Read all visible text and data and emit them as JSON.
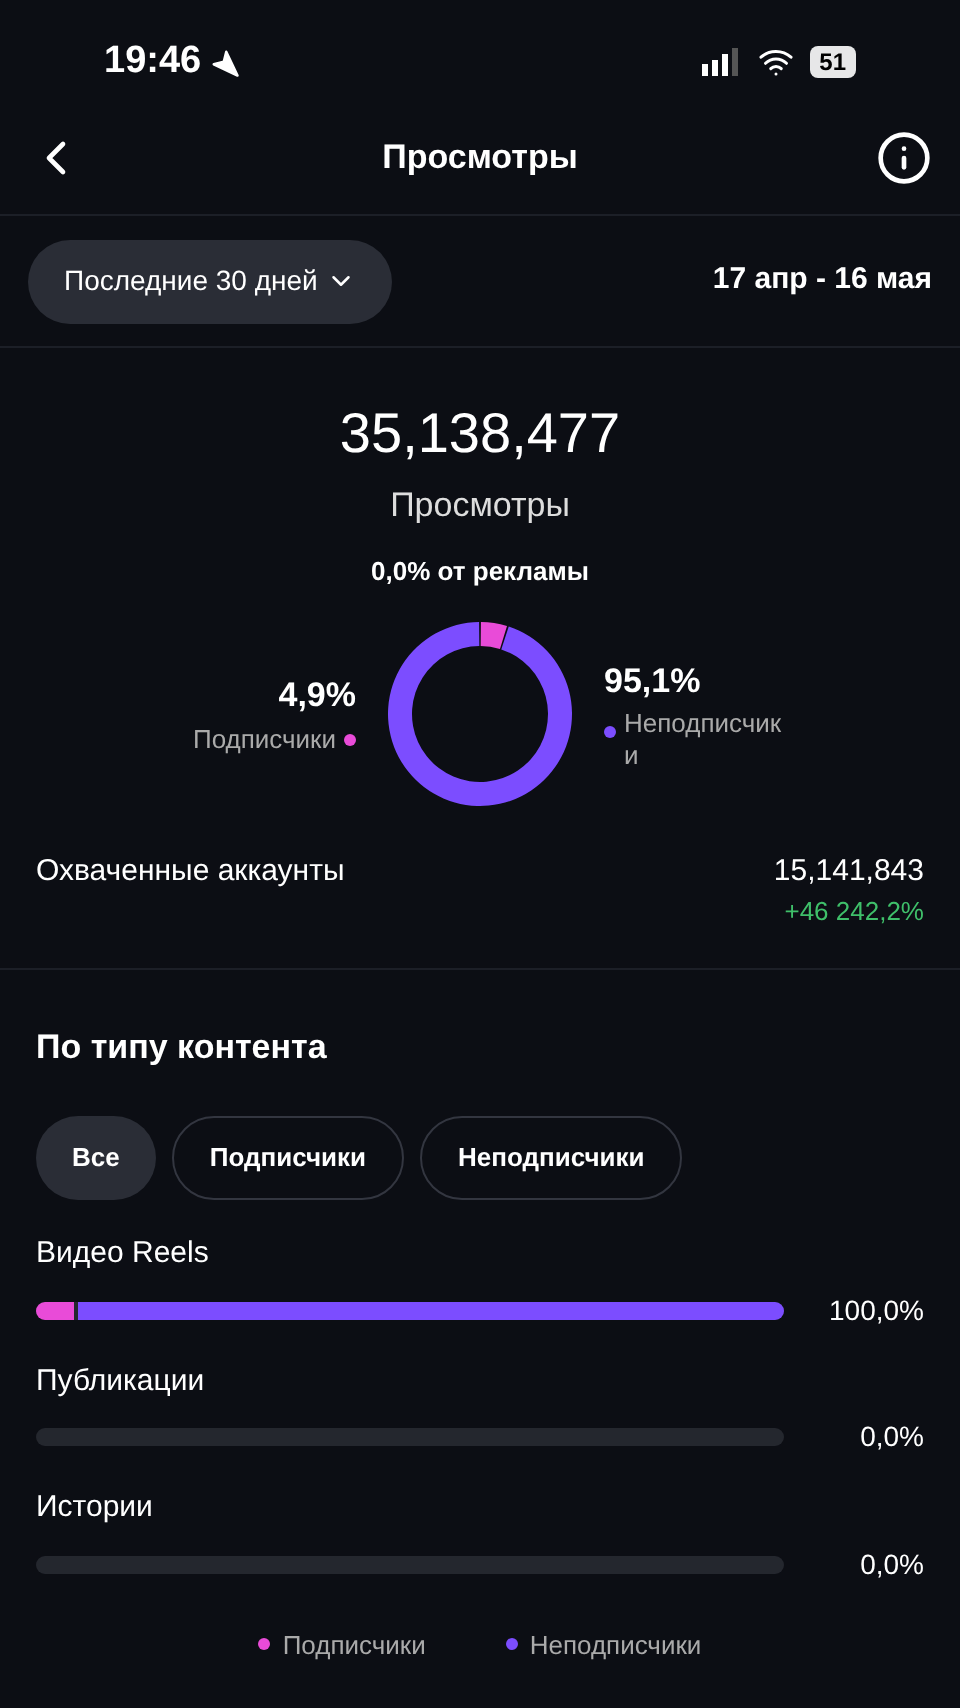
{
  "status_bar": {
    "time": "19:46",
    "battery": "51"
  },
  "header": {
    "title": "Просмотры"
  },
  "period": {
    "label": "Последние 30 дней",
    "range": "17 апр - 16 мая"
  },
  "summary": {
    "total": "35,138,477",
    "label": "Просмотры",
    "ads": "0,0% от рекламы"
  },
  "audience": [
    {
      "percent": "4,9%",
      "color": "#e94bd8"
    },
    {
      "percent": "95,1%",
      "color": "#7c4dff"
    }
  ],
  "chart_data": {
    "type": "donut",
    "categories": [
      "Подписчики",
      "Неподписчики"
    ],
    "values": [
      4.9,
      95.1
    ]
  },
  "reach": {
    "label": "Охваченные аккаунты",
    "value": "15,141,843",
    "change": "+46 242,2%"
  },
  "content": {
    "title": "По типу контента",
    "filters": [
      {
        "label": "Все",
        "selected": true
      },
      {
        "label": "Подписчики",
        "selected": false
      },
      {
        "label": "Неподписчики",
        "selected": false
      }
    ],
    "rows": [
      {
        "name": "Видео Reels",
        "reading": "100,0%",
        "segments": [
          {
            "level": 0.05
          },
          {
            "level": 0.95
          }
        ]
      },
      {
        "name": "Публикации",
        "reading": "0,0%"
      },
      {
        "name": "Истории",
        "reading": "0,0%"
      }
    ],
    "legend": [
      "Подписчики",
      "Неподписчики"
    ]
  }
}
